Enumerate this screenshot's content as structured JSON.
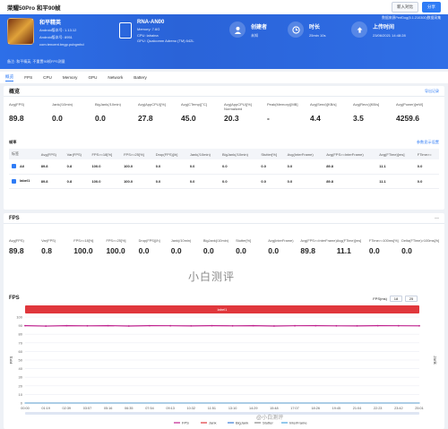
{
  "window": {
    "title": "荣耀50Pro 和平90帧"
  },
  "toolbar": {
    "btn1": "新入对比",
    "btn2": "分享"
  },
  "app": {
    "name": "和平精英",
    "version": "Android版本号: 1.13.12",
    "build": "Android版本号: 8951",
    "package": "com.tencent.tmgp.pubgmhd"
  },
  "banner_note": "备注: 和平精英, 不重置90帧FPS测量",
  "banner_right": "数据来源PerfDog(5.1.210300)数据采集",
  "device": {
    "name": "RNA-AN00",
    "memory": "Memory: 7.6G",
    "cpu": "CPU: lahaina",
    "gpu": "GPU: Qualcomm Adreno (TM) 642L"
  },
  "stats": [
    {
      "label": "创建者",
      "value": "未知",
      "icon": "user-icon"
    },
    {
      "label": "时长",
      "value": "25min 10s",
      "icon": "clock-icon"
    },
    {
      "label": "上传时间",
      "value": "23/06/2021 14:48:28",
      "icon": "upload-icon"
    }
  ],
  "tabs": [
    "概览",
    "FPS",
    "CPU",
    "Memory",
    "GPU",
    "Network",
    "Battery"
  ],
  "summary": {
    "title": "概览",
    "link": "导出记录",
    "metrics": [
      {
        "k": "Avg(FPS)",
        "v": "89.8"
      },
      {
        "k": "Jank(/10min)",
        "v": "0.0"
      },
      {
        "k": "BigJank(/10min)",
        "v": "0.0"
      },
      {
        "k": "Avg(AppCPU)[%]",
        "v": "27.8"
      },
      {
        "k": "Avg(CTemp)[°C]",
        "v": "45.0"
      },
      {
        "k": "Avg(AppCPU)[%] Normalized",
        "v": "20.3"
      },
      {
        "k": "Peak(Memory)[MB]",
        "v": "-"
      },
      {
        "k": "Avg(Send)[KB/s]",
        "v": "4.4"
      },
      {
        "k": "Avg(Recv)[KB/s]",
        "v": "3.5"
      },
      {
        "k": "Avg(Power)[mW]",
        "v": "4259.6"
      }
    ],
    "frame_label": "帧率",
    "frame_link": "参数显示设置",
    "table": {
      "headers": [
        "标签",
        "Avg(FPS)",
        "Var(FPS)",
        "FPS>=18[%]",
        "FPS>=25[%]",
        "Drop(FPS)[/h]",
        "Jank(/10min)",
        "BigJank(/10min)",
        "Stutter[%]",
        "Avg(InterFrame)",
        "Avg(FPS>=InterFrame)",
        "Avg(FTime)[ms]",
        "FTime>="
      ],
      "rows": [
        [
          "All",
          "89.8",
          "0.8",
          "100.0",
          "100.0",
          "0.0",
          "0.0",
          "0.0",
          "0.0",
          "0.0",
          "89.8",
          "11.1",
          "0.0"
        ],
        [
          "label1",
          "89.8",
          "0.8",
          "100.0",
          "100.0",
          "0.0",
          "0.0",
          "0.0",
          "0.0",
          "0.0",
          "89.8",
          "11.1",
          "0.0"
        ]
      ]
    }
  },
  "fps": {
    "title": "FPS",
    "metrics": [
      {
        "k": "Avg(FPS)",
        "v": "89.8"
      },
      {
        "k": "Var(FPS)",
        "v": "0.8"
      },
      {
        "k": "FPS>=18[%]",
        "v": "100.0"
      },
      {
        "k": "FPS>=25[%]",
        "v": "100.0"
      },
      {
        "k": "Drop(FPS)[/h]",
        "v": "0.0"
      },
      {
        "k": "Jank(/10min)",
        "v": "0.0"
      },
      {
        "k": "BigJank(/10min)",
        "v": "0.0"
      },
      {
        "k": "Stutter[%]",
        "v": "0.0"
      },
      {
        "k": "Avg(InterFrame)",
        "v": "0.0"
      },
      {
        "k": "Avg(FPS>=InterFrame)",
        "v": "89.8"
      },
      {
        "k": "Avg(FTime)[ms]",
        "v": "11.1"
      },
      {
        "k": "FTime>=100ms[%]",
        "v": "0.0"
      },
      {
        "k": "Delta(FTime)>100ms[/h]",
        "v": "0.0"
      }
    ],
    "watermark": "小白测评",
    "chart_title": "FPS",
    "range_label": "FPS(ms)",
    "range_from": "18",
    "range_to": "25"
  },
  "chart_data": {
    "type": "line",
    "title": "FPS",
    "scene_label": "label1",
    "ylabel": "FPS",
    "y2label": "Jank",
    "ylim": [
      0,
      100
    ],
    "yticks": [
      0,
      10,
      20,
      30,
      40,
      50,
      60,
      70,
      80,
      90,
      100
    ],
    "categories": [
      "00:00",
      "01:19",
      "02:39",
      "03:57",
      "05:16",
      "06:35",
      "07:54",
      "09:13",
      "10:32",
      "11:51",
      "13:10",
      "14:29",
      "15:48",
      "17:07",
      "18:26",
      "19:45",
      "21:04",
      "22:23",
      "23:42",
      "25:01"
    ],
    "series": [
      {
        "name": "FPS",
        "color": "#c0228f",
        "values": [
          90,
          89.5,
          90,
          89.8,
          90,
          89.6,
          90,
          89.9,
          89.7,
          90,
          89.8,
          90,
          89.6,
          89.9,
          90,
          89.8,
          89.7,
          90,
          89.9,
          89.8
        ]
      },
      {
        "name": "Jank",
        "color": "#e0373c",
        "values": [
          0,
          0,
          0,
          0,
          0,
          0,
          0,
          0,
          0,
          0,
          0,
          0,
          0,
          0,
          0,
          0,
          0,
          0,
          0,
          0
        ]
      },
      {
        "name": "BigJank",
        "color": "#3a7bd5",
        "values": [
          0,
          0,
          0,
          0,
          0,
          0,
          0,
          0,
          0,
          0,
          0,
          0,
          0,
          0,
          0,
          0,
          0,
          0,
          0,
          0
        ]
      },
      {
        "name": "Stutter",
        "color": "#888888",
        "values": [
          0,
          0,
          0,
          0,
          0,
          0,
          0,
          0,
          0,
          0,
          0,
          0,
          0,
          0,
          0,
          0,
          0,
          0,
          0,
          0
        ]
      },
      {
        "name": "InterFrame",
        "color": "#4aa3df",
        "values": [
          0,
          0,
          0,
          0,
          0,
          0,
          0,
          0,
          0,
          0,
          0,
          0,
          0,
          0,
          0,
          0,
          0,
          0,
          0,
          0
        ]
      }
    ],
    "grid": true,
    "legend_position": "bottom"
  },
  "watermark_bottom": "@小白测评"
}
